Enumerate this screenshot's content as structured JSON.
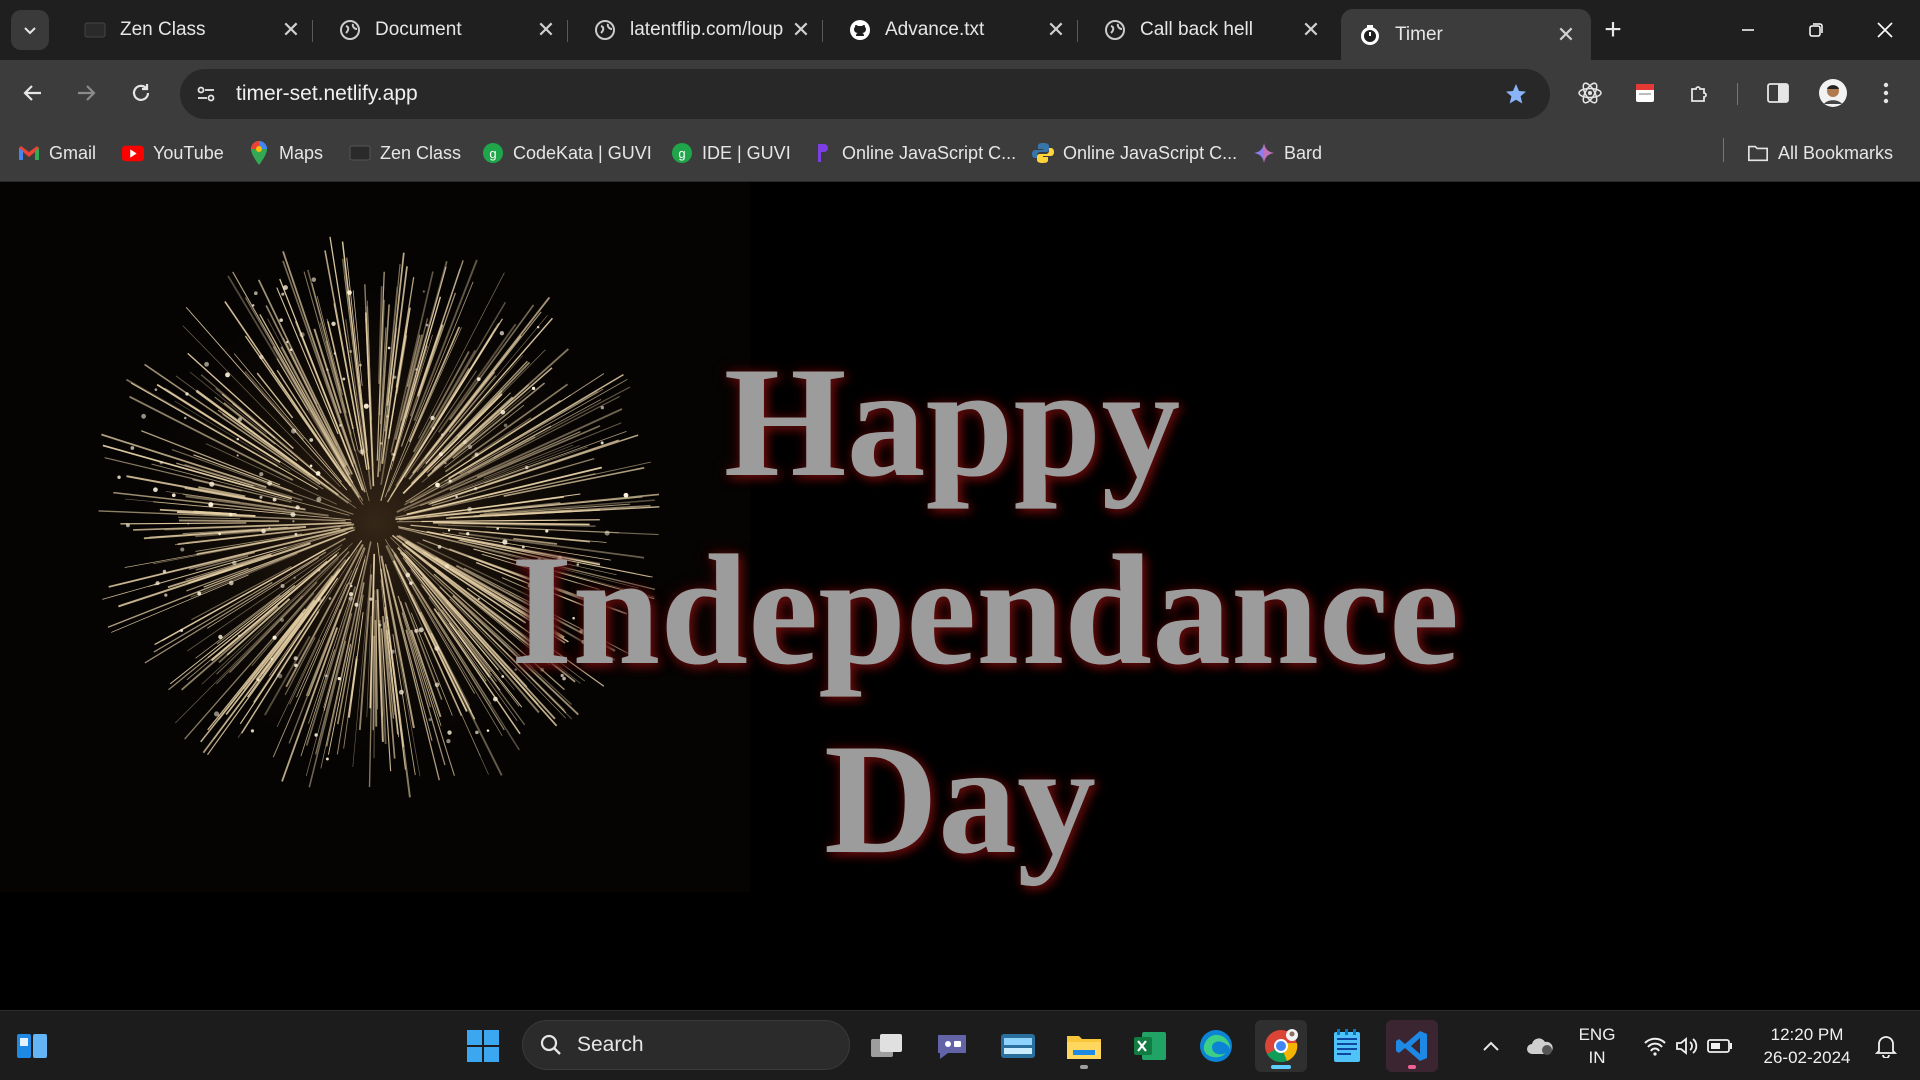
{
  "tabs": [
    {
      "title": "Zen Class",
      "icon": "zen-class-icon"
    },
    {
      "title": "Document",
      "icon": "globe-icon"
    },
    {
      "title": "latentflip.com/loup",
      "icon": "globe-icon"
    },
    {
      "title": "Advance.txt",
      "icon": "github-icon"
    },
    {
      "title": "Call back hell",
      "icon": "globe-icon"
    },
    {
      "title": "Timer",
      "icon": "timer-icon",
      "active": true
    }
  ],
  "toolbar": {
    "url": "timer-set.netlify.app"
  },
  "bookmarks": [
    {
      "label": "Gmail",
      "icon": "gmail-icon"
    },
    {
      "label": "YouTube",
      "icon": "youtube-icon"
    },
    {
      "label": "Maps",
      "icon": "maps-icon"
    },
    {
      "label": "Zen Class",
      "icon": "zen-class-icon"
    },
    {
      "label": "CodeKata | GUVI",
      "icon": "guvi-icon"
    },
    {
      "label": "IDE | GUVI",
      "icon": "guvi-icon"
    },
    {
      "label": "Online JavaScript C...",
      "icon": "programiz-icon"
    },
    {
      "label": "Online JavaScript C...",
      "icon": "python-icon"
    },
    {
      "label": "Bard",
      "icon": "bard-icon"
    }
  ],
  "all_bookmarks_label": "All Bookmarks",
  "page": {
    "line1": "Happy",
    "line2": "Independance",
    "line3": "Day"
  },
  "taskbar": {
    "search_label": "Search",
    "lang_line1": "ENG",
    "lang_line2": "IN",
    "time": "12:20 PM",
    "date": "26-02-2024"
  },
  "colors": {
    "headline": "#9c9c9c",
    "headline_glow": "#6a0d0d",
    "accent_star": "#8ab4f8",
    "firework": "#e8d2a8"
  }
}
